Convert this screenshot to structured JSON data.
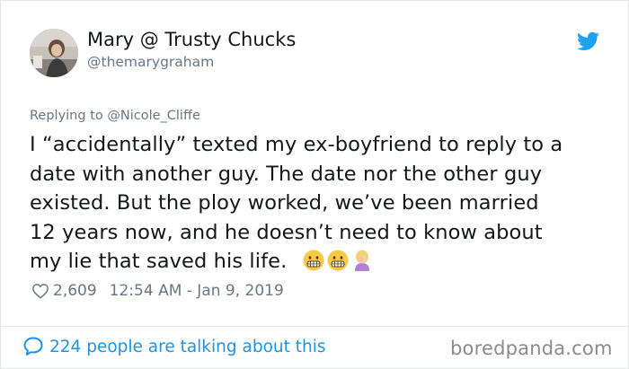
{
  "author": {
    "name": "Mary @ Trusty Chucks",
    "handle": "@themarygraham"
  },
  "tweet": {
    "reply_to": "Replying to @Nicole_Cliffe",
    "lines": [
      "I “accidentally” texted my ex-boyfriend to reply to a",
      "date with another guy. The date nor the other guy",
      "existed. But the ploy worked, we’ve been married",
      "12 years now, and he doesn’t need to know about",
      "my lie that saved his life."
    ],
    "emojis": [
      "grimacing-face-emoji",
      "grimacing-face-emoji",
      "woman-facepalming-emoji"
    ],
    "likes": "2,609",
    "timestamp": "12:54 AM - Jan 9, 2019"
  },
  "footer": {
    "talking_text": "224 people are talking about this",
    "watermark": "boredpanda.com"
  },
  "colors": {
    "twitter_blue": "#1da1f2",
    "link_blue": "#1b95e0",
    "secondary_text": "#657786"
  },
  "icons": {
    "logo": "twitter-bird-icon",
    "like": "heart-icon",
    "comments": "speech-bubble-icon"
  }
}
